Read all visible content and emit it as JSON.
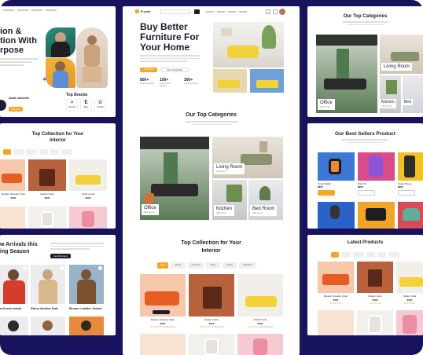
{
  "brand": {
    "name": "E·com"
  },
  "hero": {
    "title_line1": "Buy Better",
    "title_line2": "Furniture For",
    "title_line3": "Your Home",
    "cta_primary": "Shop Now",
    "cta_secondary": "Get Your Portfolio",
    "stats": [
      {
        "value": "800+",
        "label": "Project Finished"
      },
      {
        "value": "100+",
        "label": "Professional Designer"
      },
      {
        "value": "300+",
        "label": "Ongoing Project"
      }
    ]
  },
  "left_hero": {
    "title_line1": "ion &",
    "title_line2": "tion With",
    "title_line3": "rpose",
    "avatar_name": "Avail massive",
    "avatar_badge": "Discount",
    "top_brands_title": "Top Brands",
    "brands": [
      "Gaming",
      "Easy",
      "Kamilla"
    ]
  },
  "categories": {
    "title": "Our Top Categories",
    "items": [
      {
        "name": "Office",
        "count": "295 Items"
      },
      {
        "name": "Living Room",
        "count": "295 Items"
      },
      {
        "name": "Kitchen",
        "count": "295 Items"
      },
      {
        "name": "Bed Room",
        "count": "295 Items"
      }
    ]
  },
  "right_categories": {
    "title": "Our Top Categories",
    "items": [
      {
        "name": "Living Room"
      },
      {
        "name": "Office",
        "count": "295 Items"
      },
      {
        "name": "Kitchen",
        "count": "295 Items"
      },
      {
        "name": "Bed"
      }
    ]
  },
  "collection": {
    "title_line1": "Top Collection for Your",
    "title_line2": "Interior",
    "tabs": [
      "Sofa",
      "Chairs",
      "Armchairs",
      "Table",
      "Lamps",
      "Wardrobe"
    ],
    "products": [
      {
        "name": "Modern Wooden Chair",
        "price": "$200"
      },
      {
        "name": "Modern Sofa",
        "price": "$200"
      },
      {
        "name": "Fulhe's Sofa",
        "price": "$200"
      }
    ],
    "reviews": "(4 Review)"
  },
  "left_collection": {
    "title_line1": "Top Collection for Your",
    "title_line2": "Interior",
    "products": [
      {
        "name": "Modern Wooden Chair",
        "price": "$200"
      },
      {
        "name": "Modern Sofa",
        "price": "$200"
      },
      {
        "name": "Fulhe's Sofa",
        "price": "$200"
      }
    ]
  },
  "best_sellers": {
    "title": "Our Best Sellers Product",
    "products": [
      {
        "name": "Smart Watch",
        "price": "$200"
      },
      {
        "name": "iPad Pro",
        "price": "$200"
      },
      {
        "name": "Smart Phone",
        "price": "$200"
      }
    ]
  },
  "latest": {
    "title": "Latest Products",
    "products": [
      {
        "name": "Modern Wooden Chair",
        "price": "$200"
      },
      {
        "name": "Modern Sofa",
        "price": "$200"
      },
      {
        "name": "Fulhe's Sofa",
        "price": "$200"
      }
    ]
  },
  "arrivals": {
    "title_line1": "w Arrivals this",
    "title_line2": "ing Season",
    "cta": "Get Discount",
    "products": [
      {
        "name": "a Korea sekali"
      },
      {
        "name": "Shiny Golden Suit"
      },
      {
        "name": "Brown Leather Jacket"
      }
    ]
  },
  "colors": {
    "accent": "#f6a623",
    "frame": "#17135c",
    "dark": "#1c1c2e"
  }
}
